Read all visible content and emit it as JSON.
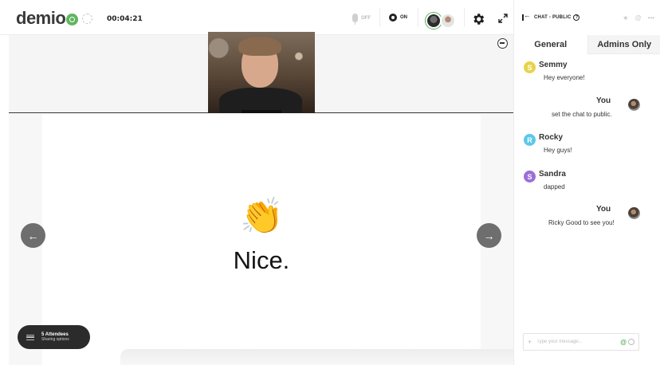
{
  "header": {
    "logo": "demio",
    "timer": "00:04:21",
    "mic_label": "OFF",
    "camera_label": "ON"
  },
  "stage": {
    "slide_text": "Nice.",
    "slide_emoji": "👏",
    "prev_icon": "arrow-left-icon",
    "next_icon": "arrow-right-icon"
  },
  "attendees": {
    "title": "5 Attendees",
    "subtitle": "Sharing options"
  },
  "chat": {
    "title": "CHAT - PUBLIC",
    "help": "?",
    "tabs": [
      "General",
      "Admins Only"
    ],
    "messages": [
      {
        "name": "Semmy",
        "avatar_letter": "S",
        "color": "#e8d34a",
        "text": "Hey everyone!"
      },
      {
        "name": "You",
        "text": "set the chat to public."
      },
      {
        "name": "Rocky",
        "avatar_letter": "R",
        "color": "#5bc8e8",
        "text": "Hey guys!"
      },
      {
        "name": "Sandra",
        "avatar_letter": "S",
        "color": "#9b6fd6",
        "text": "dapped"
      },
      {
        "name": "You",
        "text": "Ricky Good to see you!"
      }
    ],
    "composer_placeholder": "Type your message..."
  },
  "colors": {
    "accent_green": "#4caf50",
    "dark_pill": "#2b2b2b",
    "nav_button": "#6e6e6e"
  }
}
